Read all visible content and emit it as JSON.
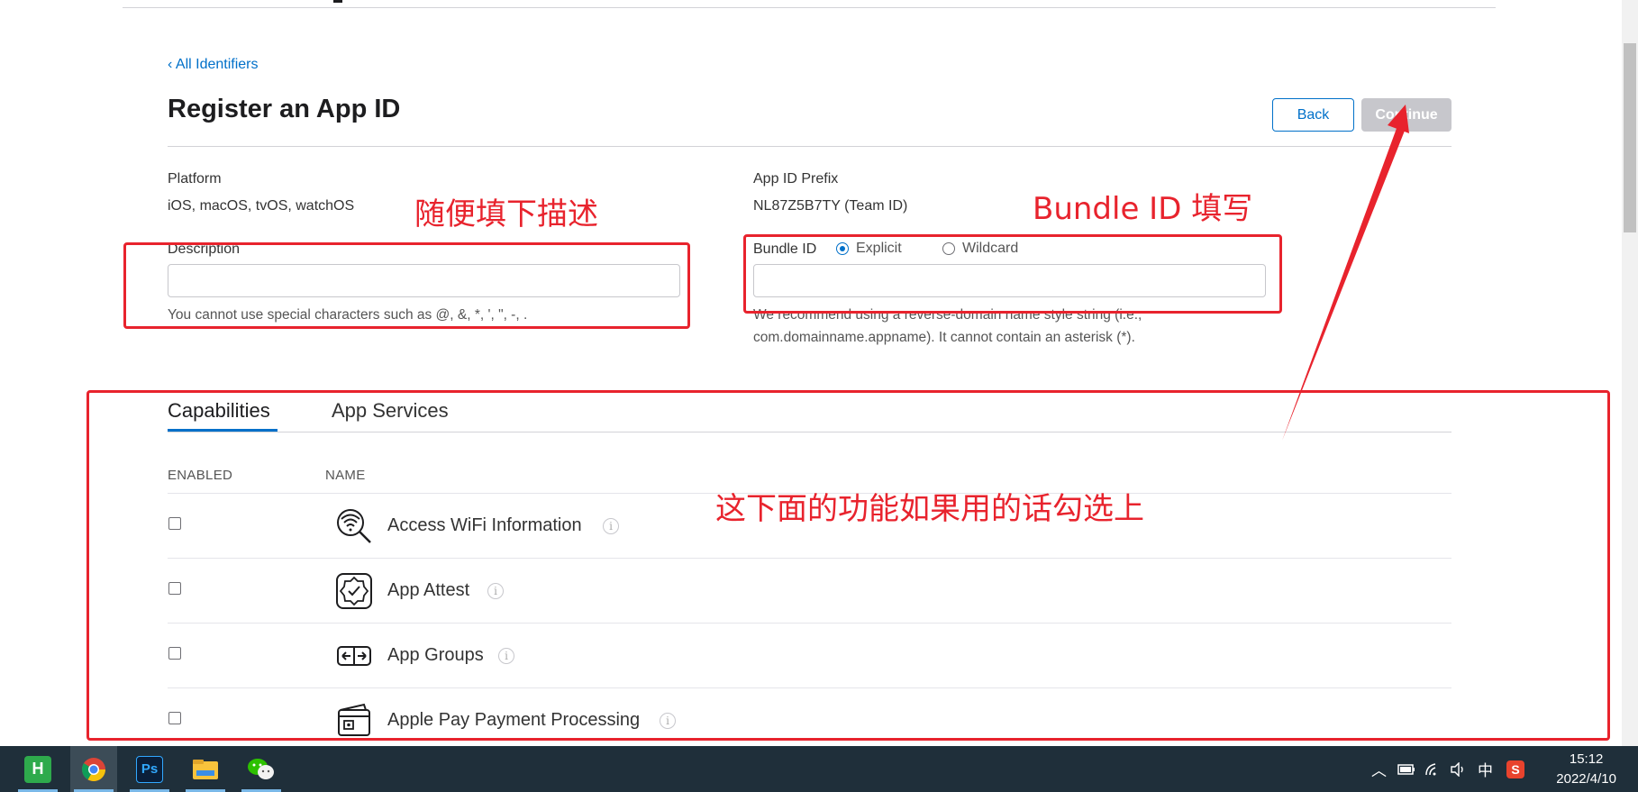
{
  "nav": {
    "breadcrumb": "‹ All Identifiers"
  },
  "page": {
    "title": "Register an App ID"
  },
  "actions": {
    "back": "Back",
    "continue": "Continue"
  },
  "form": {
    "platform_label": "Platform",
    "platform_value": "iOS, macOS, tvOS, watchOS",
    "prefix_label": "App ID Prefix",
    "prefix_value": "NL87Z5B7TY (Team ID)",
    "description_label": "Description",
    "description_value": "",
    "description_hint": "You cannot use special characters such as @, &, *, ', \", -, .",
    "bundle_label": "Bundle ID",
    "bundle_explicit": "Explicit",
    "bundle_wildcard": "Wildcard",
    "bundle_value": "",
    "bundle_hint_1": "We recommend using a reverse-domain name style string (i.e.,",
    "bundle_hint_2": "com.domainname.appname). It cannot contain an asterisk (*)."
  },
  "annotations": {
    "description": "随便填下描述",
    "bundle": "Bundle  ID 填写",
    "capabilities": "这下面的功能如果用的话勾选上",
    "color": "#e8232d"
  },
  "tabs": [
    {
      "label": "Capabilities"
    },
    {
      "label": "App Services"
    }
  ],
  "table": {
    "col_enabled": "ENABLED",
    "col_name": "NAME",
    "rows": [
      {
        "name": "Access WiFi Information",
        "icon": "wifi-search-icon",
        "enabled": false
      },
      {
        "name": "App Attest",
        "icon": "badge-check-icon",
        "enabled": false
      },
      {
        "name": "App Groups",
        "icon": "app-groups-icon",
        "enabled": false
      },
      {
        "name": "Apple Pay Payment Processing",
        "icon": "wallet-card-icon",
        "enabled": false
      }
    ]
  },
  "taskbar": {
    "apps": [
      "hbuilder-icon",
      "chrome-icon",
      "photoshop-icon",
      "file-explorer-icon",
      "wechat-icon"
    ],
    "ime": "中",
    "time": "15:12",
    "date": "2022/4/10"
  }
}
